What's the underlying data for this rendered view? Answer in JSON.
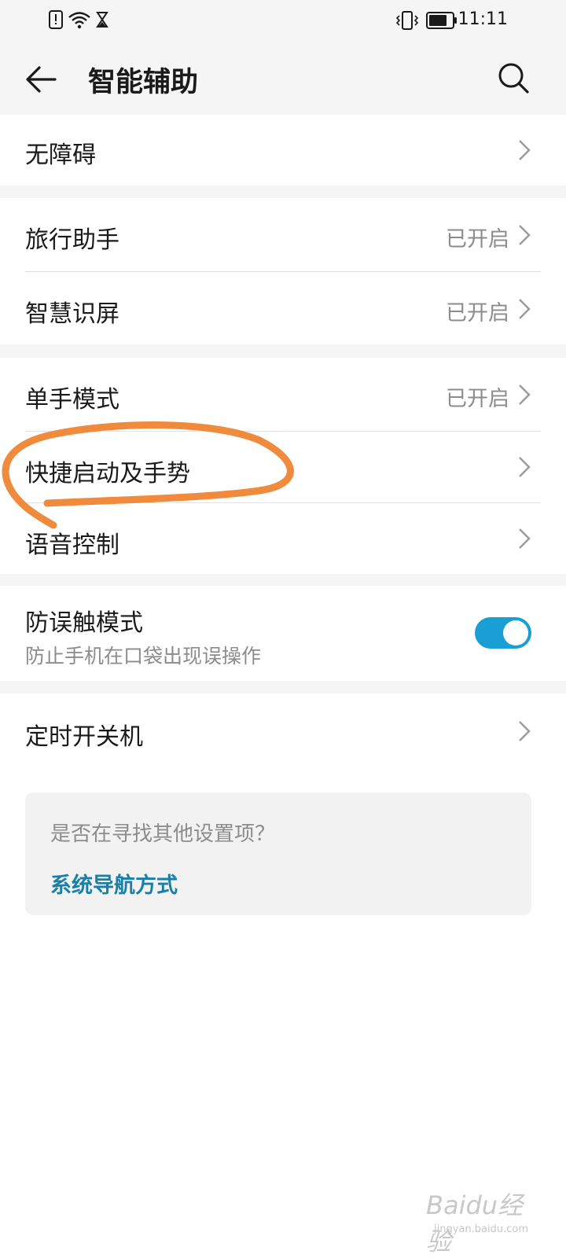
{
  "status_bar": {
    "time": "11:11",
    "left_icons": [
      "alert-notification-icon",
      "wifi-icon",
      "hourglass-icon"
    ],
    "right_icons": [
      "vibrate-icon",
      "battery-icon"
    ]
  },
  "app_bar": {
    "title": "智能辅助",
    "back_icon": "arrow-left-icon",
    "search_icon": "search-icon"
  },
  "sections": [
    {
      "items": [
        {
          "label": "无障碍",
          "value": ""
        }
      ]
    },
    {
      "items": [
        {
          "label": "旅行助手",
          "value": "已开启"
        },
        {
          "label": "智慧识屏",
          "value": "已开启"
        }
      ]
    },
    {
      "items": [
        {
          "label": "单手模式",
          "value": "已开启"
        },
        {
          "label": "快捷启动及手势",
          "value": ""
        },
        {
          "label": "语音控制",
          "value": ""
        }
      ]
    },
    {
      "items": [
        {
          "label": "防误触模式",
          "sublabel": "防止手机在口袋出现误操作",
          "toggle_on": true
        }
      ]
    },
    {
      "items": [
        {
          "label": "定时开关机",
          "value": ""
        }
      ]
    }
  ],
  "suggestion_card": {
    "prompt": "是否在寻找其他设置项？",
    "link": "系统导航方式"
  },
  "colors": {
    "accent": "#1a9fd4",
    "link": "#1a7fa6",
    "annotation": "#f08a3c",
    "background_gray": "#f5f5f5"
  },
  "watermark": {
    "text": "Baidu经验",
    "url_text": "jingyan.baidu.com"
  }
}
